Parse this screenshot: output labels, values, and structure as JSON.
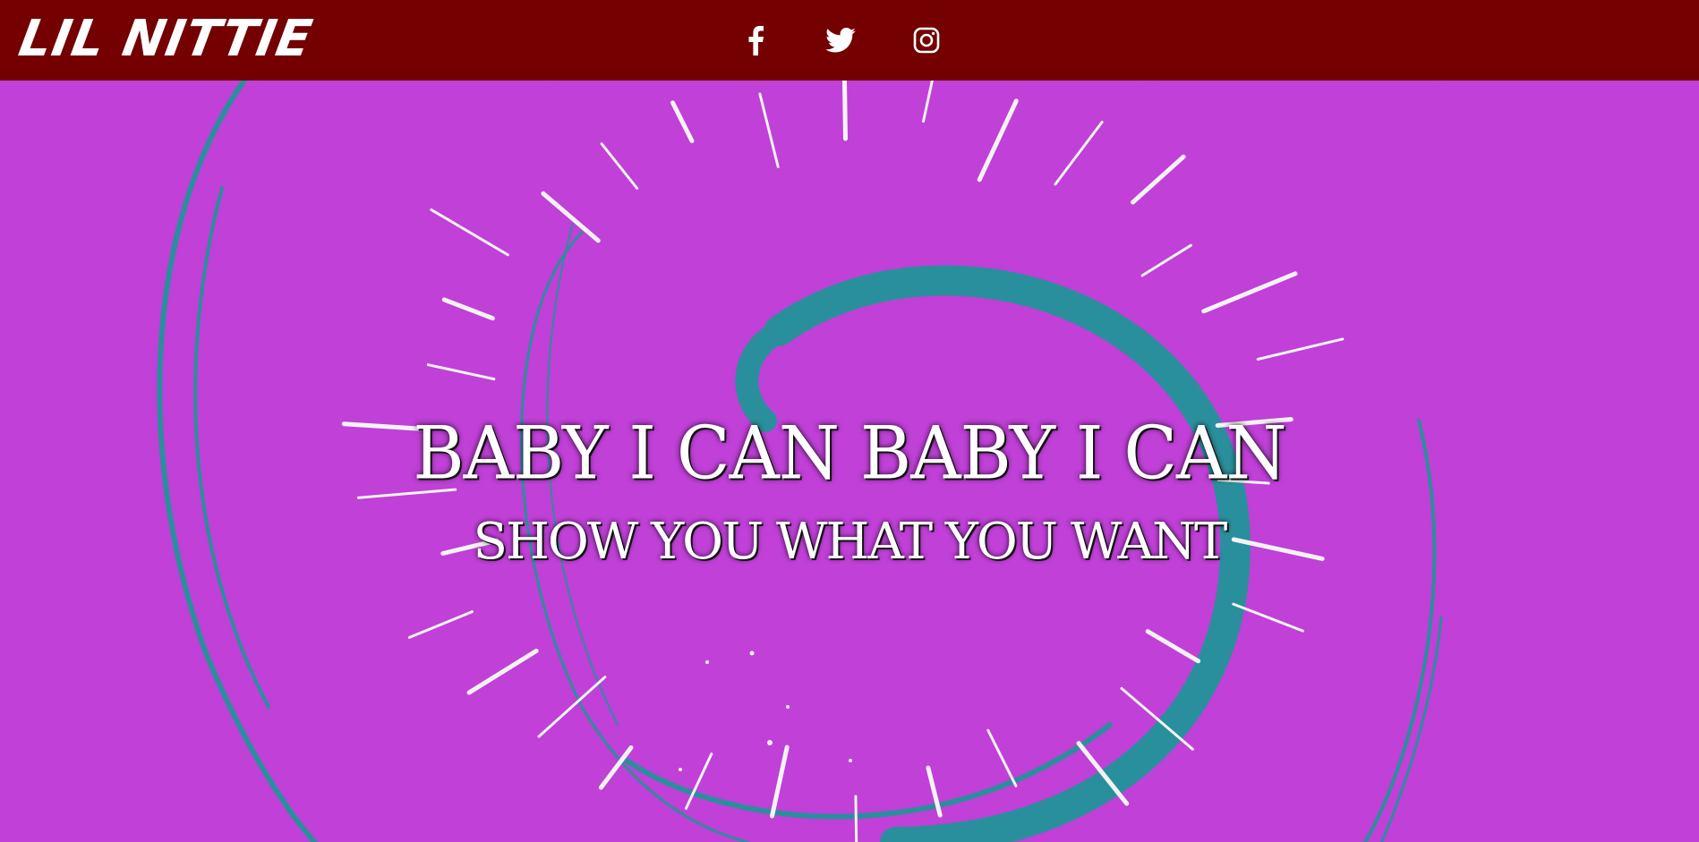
{
  "header": {
    "logo_text": "LIL NITTIE",
    "background_color": "#740002",
    "social": [
      {
        "name": "facebook",
        "icon": "facebook-icon"
      },
      {
        "name": "twitter",
        "icon": "twitter-icon"
      },
      {
        "name": "instagram",
        "icon": "instagram-icon"
      }
    ]
  },
  "hero": {
    "lyric_line_1": "BABY I CAN BABY I CAN",
    "lyric_line_2": "SHOW YOU WHAT YOU WANT",
    "colors": {
      "neon_hex": "#c040d8",
      "brush_circle": "#2a8f9c",
      "text": "#ffffff"
    }
  }
}
